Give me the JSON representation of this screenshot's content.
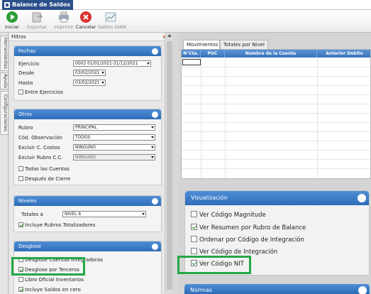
{
  "window": {
    "title": "Balance de Saldos"
  },
  "toolbar": {
    "iniciar": "Iniciar",
    "exportar": "Exportar",
    "imprimir": "Imprimir",
    "cancelar": "Cancelar",
    "saldos_dian": "Saldos DIAN"
  },
  "sidetabs": [
    "Herramientas",
    "Ayuda",
    "Configuraciones"
  ],
  "filters": {
    "header": "Filtros",
    "fechas": {
      "title": "Fechas",
      "ejercicio_label": "Ejercicio",
      "ejercicio_value": "0002 01/01/2021-31/12/2021",
      "desde_label": "Desde",
      "desde_value": "03/02/2021",
      "hasta_label": "Hasta",
      "hasta_value": "03/02/2021",
      "entre_ejercicios": "Entre Ejercicios"
    },
    "otros": {
      "title": "Otros",
      "rubro_label": "Rubro",
      "rubro_value": "PRINCIPAL",
      "cod_obs_label": "Cód. Observación",
      "cod_obs_value": "TODOS",
      "excluir_cc_label": "Excluir C. Costos",
      "excluir_cc_value": "NINGUNO",
      "excluir_rubro_label": "Excluir Rubro C.C.",
      "excluir_rubro_value": "NINGUNO",
      "todas_cuentas": "Todas las Cuentas",
      "despues_cierre": "Después de Cierre"
    },
    "niveles": {
      "title": "Niveles",
      "totales_label": "Totales a",
      "totales_value": "NIVEL 6",
      "incluye_rubros": "Incluye Rubros Totalizadores"
    },
    "desglose": {
      "title": "Desglose",
      "items": [
        {
          "label": "Desglose Cuentas Integradoras",
          "checked": false
        },
        {
          "label": "Desglose por Terceros",
          "checked": true
        },
        {
          "label": "Libro Oficial Inventarios",
          "checked": false
        },
        {
          "label": "Incluye Saldos en cero",
          "checked": true
        }
      ]
    }
  },
  "tabs": [
    "Movimientos",
    "Totales por Nivel"
  ],
  "grid": {
    "columns": [
      "N°Cta.",
      "PUC",
      "Nombre de la Cuenta",
      "Anterior Debito"
    ]
  },
  "visualizacion": {
    "title": "Visualización",
    "items": [
      {
        "label": "Ver Código Magnitude",
        "checked": false
      },
      {
        "label": "Ver Resumen por Rubro de Balance",
        "checked": true
      },
      {
        "label": "Ordenar por  Código de Integración",
        "checked": false
      },
      {
        "label": "Ver Código de Integración",
        "checked": false
      },
      {
        "label": "Ver Código NIT",
        "checked": true
      }
    ]
  },
  "normas": {
    "title": "Normas"
  },
  "colors": {
    "accent": "#2d6db9",
    "highlight": "#23a845",
    "title_tab": "#2b4f8a"
  }
}
